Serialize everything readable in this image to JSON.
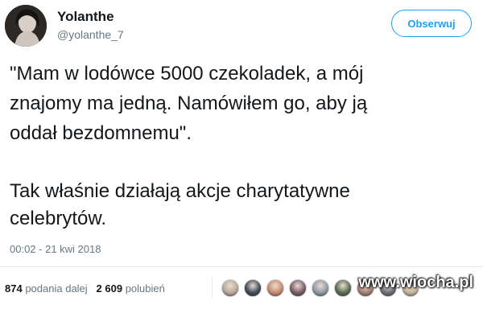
{
  "user": {
    "display_name": "Yolanthe",
    "handle": "@yolanthe_7"
  },
  "follow_button": {
    "label": "Obserwuj"
  },
  "tweet": {
    "lines": [
      "\"Mam w lodówce 5000 czekoladek, a mój",
      "znajomy ma jedną. Namówiłem go, aby ją",
      "oddał bezdomnemu\".",
      "Tak właśnie działają akcje charytatywne",
      "celebrytów."
    ],
    "timestamp": "00:02 - 21 kwi 2018"
  },
  "stats": {
    "retweets_count": "874",
    "retweets_label": "podania dalej",
    "likes_count": "2 609",
    "likes_label": "polubień"
  },
  "likers": [
    {
      "color": "#b9a99a"
    },
    {
      "color": "#3f4a56"
    },
    {
      "color": "#c98a6e"
    },
    {
      "color": "#7a5c66"
    },
    {
      "color": "#8e9aa5"
    },
    {
      "color": "#5b6b52"
    },
    {
      "color": "#a47f72"
    },
    {
      "color": "#6d6d75"
    },
    {
      "color": "#c7b39c"
    }
  ],
  "watermark": {
    "text": "www.wiocha.pl"
  }
}
